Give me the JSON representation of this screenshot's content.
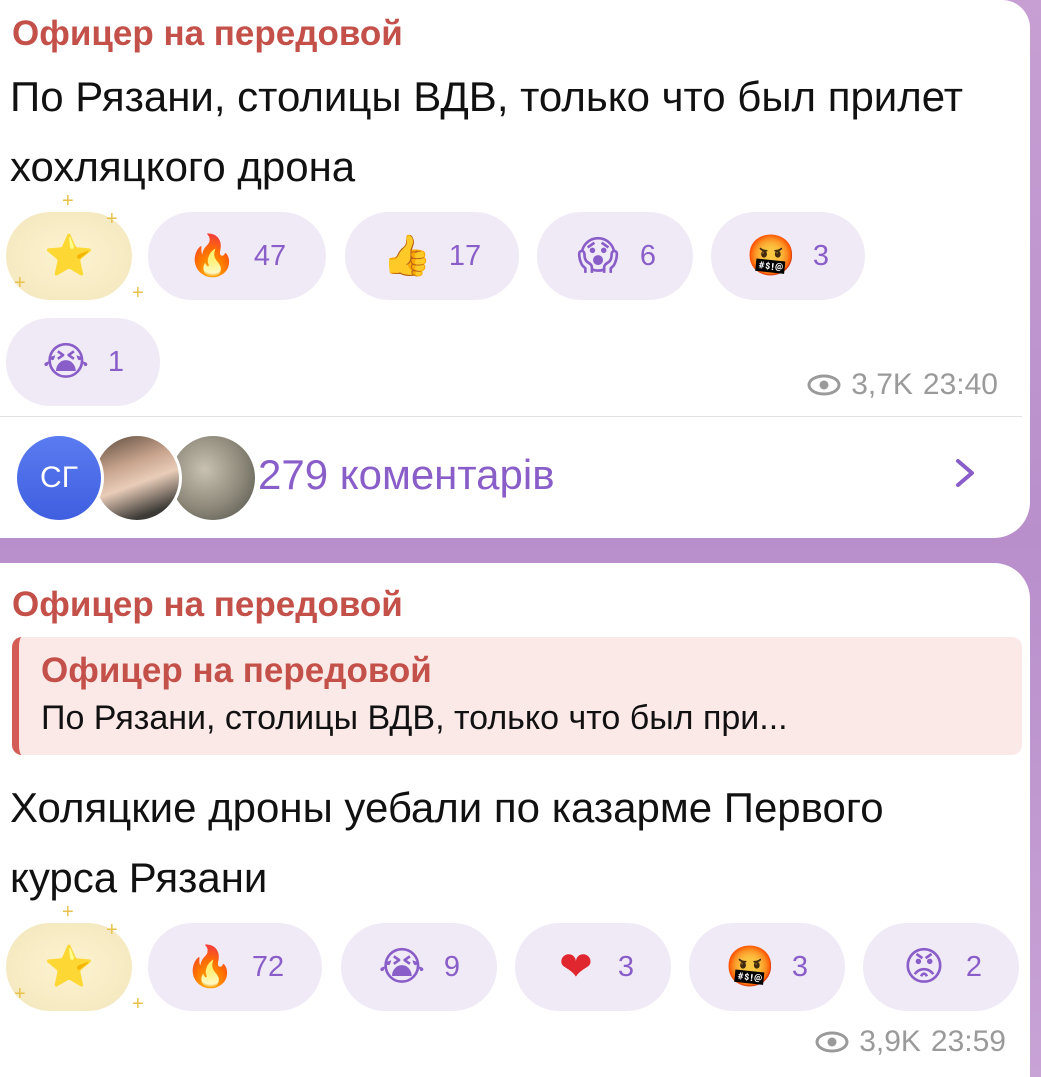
{
  "messages": [
    {
      "author": "Офицер на передовой",
      "text": "По Рязани, столицы ВДВ, только что был прилет хохляцкого дрона",
      "reactions": [
        {
          "emoji": "🔥",
          "icon": "fire-icon",
          "count": "47"
        },
        {
          "emoji": "👍",
          "icon": "thumbs-up-icon",
          "count": "17"
        },
        {
          "emoji": "😱",
          "icon": "screaming-face-icon",
          "count": "6"
        },
        {
          "emoji": "🤬",
          "icon": "cursing-face-icon",
          "count": "3"
        },
        {
          "emoji": "😭",
          "icon": "crying-face-icon",
          "count": "1"
        }
      ],
      "views": "3,7K",
      "time": "23:40",
      "comments": {
        "avatar_initials": "СГ",
        "label": "279 коментарів"
      }
    },
    {
      "author": "Офицер на передовой",
      "reply": {
        "author": "Офицер на передовой",
        "text": "По Рязани, столицы ВДВ, только что был при..."
      },
      "text": "Холяцкие дроны уебали по казарме Первого курса Рязани",
      "reactions": [
        {
          "emoji": "🔥",
          "icon": "fire-icon",
          "count": "72"
        },
        {
          "emoji": "😭",
          "icon": "crying-face-icon",
          "count": "9"
        },
        {
          "emoji": "❤",
          "icon": "heart-icon",
          "count": "3"
        },
        {
          "emoji": "🤬",
          "icon": "cursing-face-icon",
          "count": "3"
        },
        {
          "emoji": "😡",
          "icon": "angry-face-icon",
          "count": "2"
        }
      ],
      "views": "3,9K",
      "time": "23:59"
    }
  ],
  "colors": {
    "author": "#c4504a",
    "accent": "#8a5ec9",
    "reaction_bg": "#f0eaf6",
    "quote_bg": "#fbe9e8",
    "meta": "#9a9a9a"
  }
}
